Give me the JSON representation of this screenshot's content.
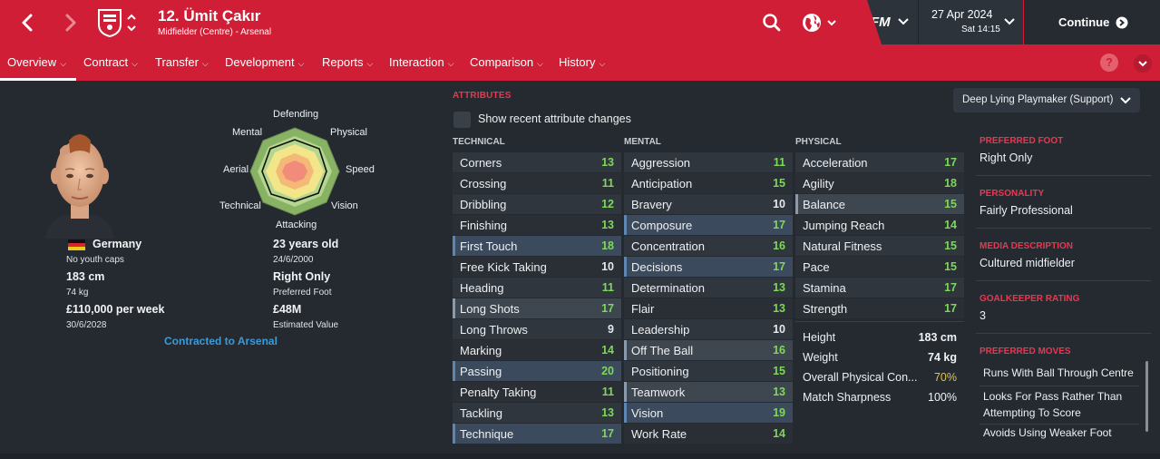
{
  "header": {
    "player_title": "12. Ümit Çakır",
    "player_subtitle": "Midfielder (Centre) - Arsenal",
    "fm_label": "FM",
    "date": "27 Apr 2024",
    "time": "Sat 14:15",
    "continue_label": "Continue"
  },
  "tabs": [
    "Overview",
    "Contract",
    "Transfer",
    "Development",
    "Reports",
    "Interaction",
    "Comparison",
    "History"
  ],
  "profile": {
    "nationality": "Germany",
    "youth_caps": "No youth caps",
    "height": "183 cm",
    "weight": "74 kg",
    "wage": "£110,000 per week",
    "contract_end": "30/6/2028",
    "age": "23 years old",
    "dob": "24/6/2000",
    "foot": "Right Only",
    "foot_label": "Preferred Foot",
    "value": "£48M",
    "value_label": "Estimated Value",
    "contract_status": "Contracted to Arsenal"
  },
  "radar": {
    "labels": [
      "Defending",
      "Physical",
      "Speed",
      "Vision",
      "Attacking",
      "Technical",
      "Aerial",
      "Mental"
    ]
  },
  "attributes": {
    "title": "ATTRIBUTES",
    "show_changes": "Show recent attribute changes",
    "role": "Deep Lying Playmaker (Support)",
    "technical_head": "TECHNICAL",
    "mental_head": "MENTAL",
    "physical_head": "PHYSICAL",
    "technical": [
      {
        "name": "Corners",
        "value": "13"
      },
      {
        "name": "Crossing",
        "value": "11"
      },
      {
        "name": "Dribbling",
        "value": "12"
      },
      {
        "name": "Finishing",
        "value": "13"
      },
      {
        "name": "First Touch",
        "value": "18"
      },
      {
        "name": "Free Kick Taking",
        "value": "10"
      },
      {
        "name": "Heading",
        "value": "11"
      },
      {
        "name": "Long Shots",
        "value": "17"
      },
      {
        "name": "Long Throws",
        "value": "9"
      },
      {
        "name": "Marking",
        "value": "14"
      },
      {
        "name": "Passing",
        "value": "20"
      },
      {
        "name": "Penalty Taking",
        "value": "11"
      },
      {
        "name": "Tackling",
        "value": "13"
      },
      {
        "name": "Technique",
        "value": "17"
      }
    ],
    "mental": [
      {
        "name": "Aggression",
        "value": "11"
      },
      {
        "name": "Anticipation",
        "value": "15"
      },
      {
        "name": "Bravery",
        "value": "10"
      },
      {
        "name": "Composure",
        "value": "17"
      },
      {
        "name": "Concentration",
        "value": "16"
      },
      {
        "name": "Decisions",
        "value": "17"
      },
      {
        "name": "Determination",
        "value": "13"
      },
      {
        "name": "Flair",
        "value": "13"
      },
      {
        "name": "Leadership",
        "value": "10"
      },
      {
        "name": "Off The Ball",
        "value": "16"
      },
      {
        "name": "Positioning",
        "value": "15"
      },
      {
        "name": "Teamwork",
        "value": "13"
      },
      {
        "name": "Vision",
        "value": "19"
      },
      {
        "name": "Work Rate",
        "value": "14"
      }
    ],
    "physical": [
      {
        "name": "Acceleration",
        "value": "17"
      },
      {
        "name": "Agility",
        "value": "18"
      },
      {
        "name": "Balance",
        "value": "15"
      },
      {
        "name": "Jumping Reach",
        "value": "14"
      },
      {
        "name": "Natural Fitness",
        "value": "15"
      },
      {
        "name": "Pace",
        "value": "15"
      },
      {
        "name": "Stamina",
        "value": "17"
      },
      {
        "name": "Strength",
        "value": "17"
      }
    ],
    "extra": [
      {
        "name": "Height",
        "value": "183 cm"
      },
      {
        "name": "Weight",
        "value": "74 kg"
      },
      {
        "name": "Overall Physical Con...",
        "value": "70%"
      },
      {
        "name": "Match Sharpness",
        "value": "100%"
      }
    ]
  },
  "info": {
    "foot_label": "PREFERRED FOOT",
    "foot": "Right Only",
    "personality_label": "PERSONALITY",
    "personality": "Fairly Professional",
    "media_label": "MEDIA DESCRIPTION",
    "media": "Cultured midfielder",
    "gk_label": "GOALKEEPER RATING",
    "gk": "3",
    "moves_label": "PREFERRED MOVES",
    "moves": [
      "Runs With Ball Through Centre",
      "Looks For Pass Rather Than Attempting To Score",
      "Avoids Using Weaker Foot"
    ]
  },
  "colors": {
    "brand_red": "#cf1e35",
    "value_green": "#7ed957",
    "value_white": "#e6e8eb",
    "value_yellow": "#e6c14a"
  }
}
